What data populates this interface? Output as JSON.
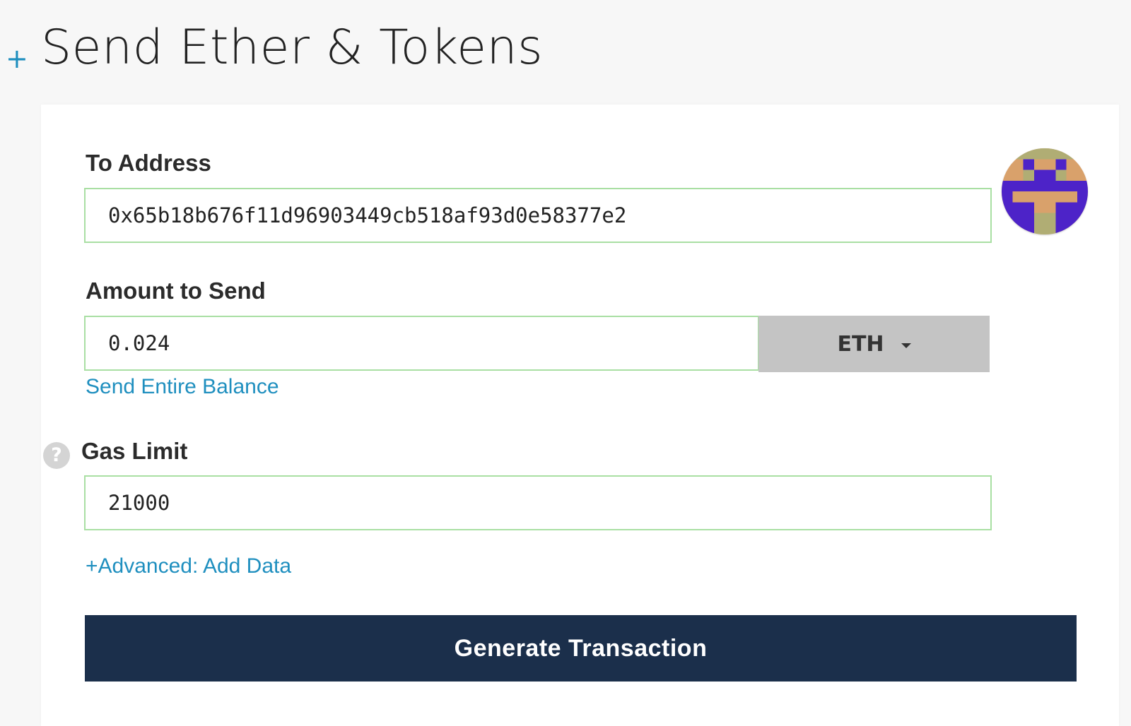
{
  "header": {
    "collapse_symbol": "+",
    "title": "Send Ether & Tokens"
  },
  "form": {
    "to_address": {
      "label": "To Address",
      "value": "0x65b18b676f11d96903449cb518af93d0e58377e2"
    },
    "amount": {
      "label": "Amount to Send",
      "value": "0.024",
      "unit": "ETH",
      "send_entire_balance": "Send Entire Balance"
    },
    "gas_limit": {
      "label": "Gas Limit",
      "help_symbol": "?",
      "value": "21000"
    },
    "advanced_link": "+Advanced: Add Data",
    "generate_button": "Generate Transaction"
  },
  "colors": {
    "accent": "#1f8fbf",
    "button": "#1b2f4b",
    "input_border": "#a9dfa3",
    "unit_bg": "#c4c4c4",
    "identicon_purple": "#4d23c8",
    "identicon_tan": "#d9a16b",
    "identicon_olive": "#b0ad74"
  }
}
